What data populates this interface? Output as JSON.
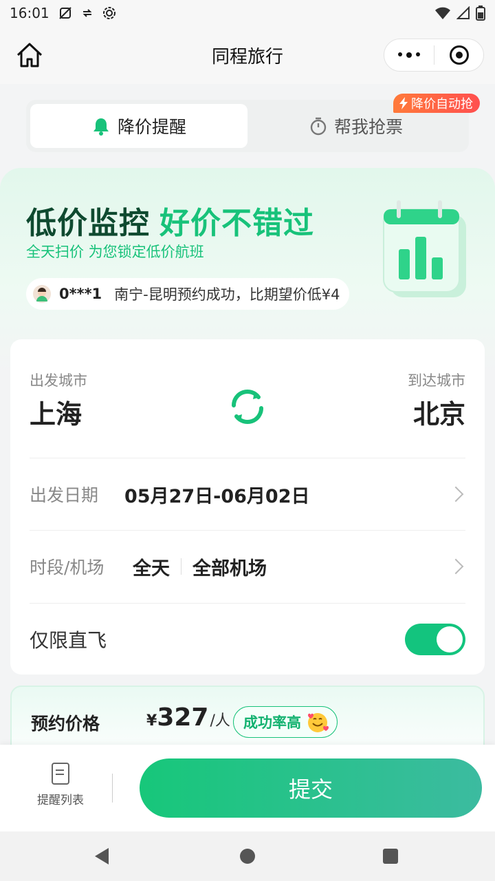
{
  "status_bar": {
    "time": "16:01"
  },
  "title_bar": {
    "title": "同程旅行"
  },
  "tabs": {
    "items": [
      {
        "label": "降价提醒",
        "active": true
      },
      {
        "label": "帮我抢票",
        "active": false
      }
    ],
    "badge": "降价自动抢"
  },
  "hero": {
    "headline_dark": "低价监控",
    "headline_green": "好价不错过",
    "subtitle": "全天扫价 为您锁定低价航班",
    "ticker_user": "0***1",
    "ticker_text": "南宁-昆明预约成功，比期望价低¥4"
  },
  "route": {
    "from_label": "出发城市",
    "from_city": "上海",
    "to_label": "到达城市",
    "to_city": "北京"
  },
  "date_row": {
    "label": "出发日期",
    "value": "05月27日-06月02日"
  },
  "time_row": {
    "label": "时段/机场",
    "time_value": "全天",
    "airport_value": "全部机场"
  },
  "direct_row": {
    "label": "仅限直飞",
    "enabled": true
  },
  "price": {
    "label": "预约价格",
    "currency": "¥",
    "amount": "327",
    "unit": "/人",
    "badge": "成功率高"
  },
  "bottom": {
    "list_label": "提醒列表",
    "submit_label": "提交"
  },
  "colors": {
    "accent": "#13c47e",
    "badge_orange": "#ff5a3c"
  }
}
